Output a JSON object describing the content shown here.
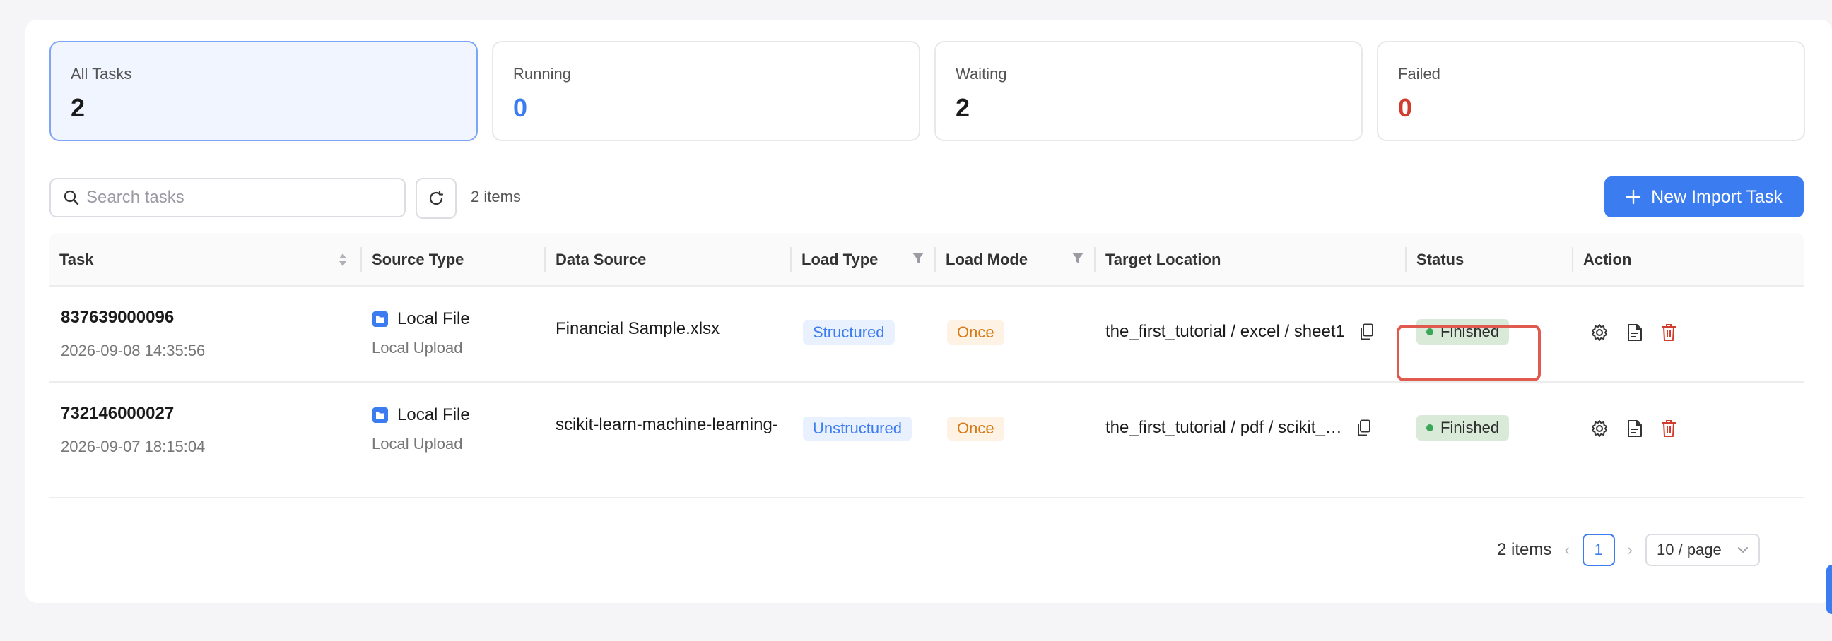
{
  "stats": [
    {
      "label": "All Tasks",
      "value": "2"
    },
    {
      "label": "Running",
      "value": "0"
    },
    {
      "label": "Waiting",
      "value": "2"
    },
    {
      "label": "Failed",
      "value": "0"
    }
  ],
  "toolbar": {
    "search_placeholder": "Search tasks",
    "items_count": "2 items",
    "new_task_label": "New Import Task"
  },
  "table": {
    "headers": [
      "Task",
      "Source Type",
      "Data Source",
      "Load Type",
      "Load Mode",
      "Target Location",
      "Status",
      "Action"
    ],
    "rows": [
      {
        "task_id": "837639000096",
        "date": "2026-09-08 14:35:56",
        "source_type": "Local File",
        "source_sub": "Local Upload",
        "data_source": "Financial Sample.xlsx",
        "load_type": "Structured",
        "load_mode": "Once",
        "target": "the_first_tutorial / excel / sheet1",
        "status": "Finished"
      },
      {
        "task_id": "732146000027",
        "date": "2026-09-07 18:15:04",
        "source_type": "Local File",
        "source_sub": "Local Upload",
        "data_source": "scikit-learn-machine-learning-",
        "load_type": "Unstructured",
        "load_mode": "Once",
        "target": "the_first_tutorial / pdf / scikit_…",
        "status": "Finished"
      }
    ]
  },
  "pagination": {
    "total": "2 items",
    "current_page": "1",
    "page_size": "10 / page"
  },
  "colors": {
    "accent": "#3b7cf0",
    "failed": "#d23c2e",
    "finished_bg": "#d9ead9",
    "highlight": "#e05a4f"
  }
}
